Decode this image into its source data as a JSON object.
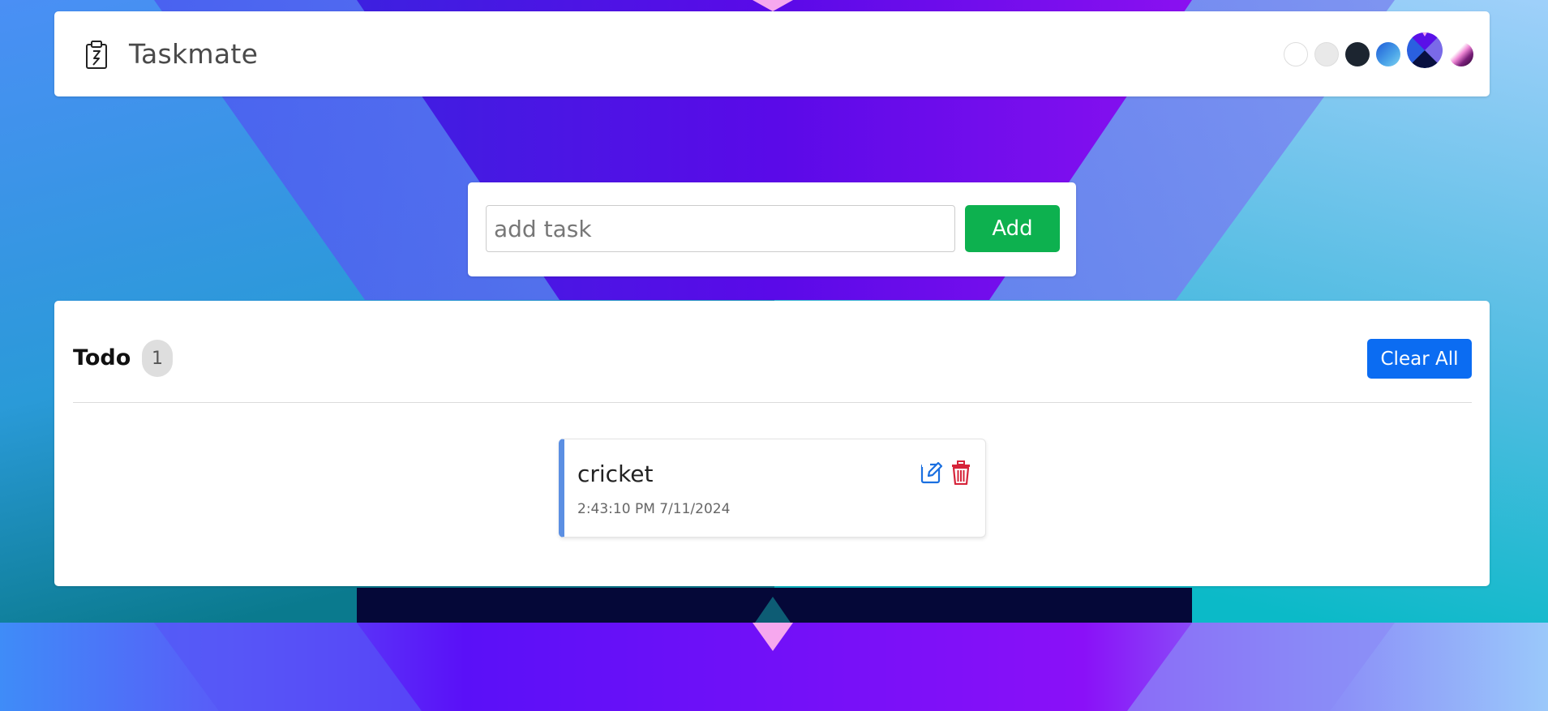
{
  "navbar": {
    "brand": "Taskmate",
    "themes": [
      "light",
      "gray",
      "dark",
      "blue",
      "violet",
      "pink"
    ]
  },
  "add_form": {
    "placeholder": "add task",
    "value": "",
    "button_label": "Add"
  },
  "todo": {
    "title": "Todo",
    "count": "1",
    "clear_label": "Clear All",
    "tasks": [
      {
        "name": "cricket",
        "time": "2:43:10 PM 7/11/2024"
      }
    ]
  },
  "colors": {
    "add_button": "#0db14f",
    "clear_button": "#0b6cf2",
    "task_accent": "#5b8fe3",
    "edit_icon": "#1a6fe0",
    "delete_icon": "#d6243a"
  }
}
